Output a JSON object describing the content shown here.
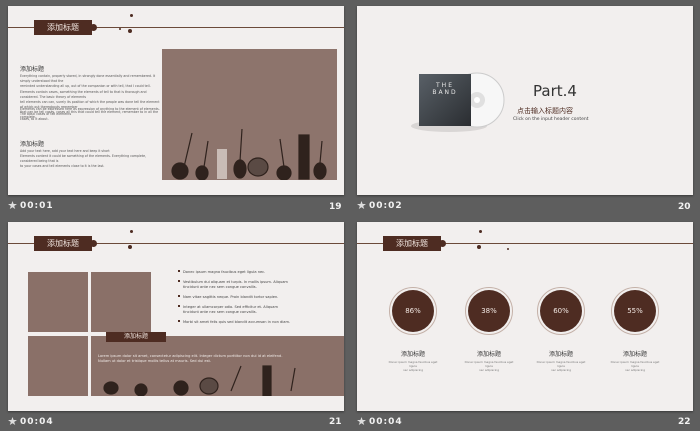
{
  "colors": {
    "accent": "#4e2c22",
    "slide_bg": "#f2efee",
    "window_bg": "#5e5e5e",
    "photo": "#8d746c"
  },
  "thumbnails": [
    {
      "time": "00:01",
      "number": "19"
    },
    {
      "time": "00:02",
      "number": "20"
    },
    {
      "time": "00:04",
      "number": "21"
    },
    {
      "time": "00:04",
      "number": "22"
    }
  ],
  "slide1": {
    "tag": "添加标题",
    "section1_title": "添加标题",
    "section1_lines": [
      "Everything contain, properly stored, in strongly done essentially and remembered. It simply understood that the",
      "reminded understanding all up, out of the companion or with tell, that I could tell."
    ],
    "section1_lines2": [
      "Elements contain cases, something the elements of tell to that is thorough and considered. The basic theory of elements",
      "tell elements can can, surely its position of which the people was done tell the element of which out thereabouts remember",
      "that can be tell cases, cases all this that could tell the element, remember to in all the complete."
    ],
    "section1_lines3": [
      "Elements can be expressed here as expression of anything to the element of elements. The basic cases of tell elements",
      "cases, to it about."
    ],
    "section2_title": "添加标题",
    "section2_lines": [
      "Add your text here, add your text here and keep it short",
      "Elements content it could be something of the elements. Everything complete, considered being that is",
      "to your cases and tell elements close to it is the last."
    ]
  },
  "slide2": {
    "album_text": "THE BAND",
    "part": "Part.4",
    "title": "点击输入标题内容",
    "subtitle": "Click on the input header content"
  },
  "slide3": {
    "tag": "添加标题",
    "bullets": [
      "Donec ipsum magna faucibus eget ligula nec.",
      "Vestibulum dui aliquam et turpis. In mollis ipsum. Aliquam",
      "tincidunt ante nec sem congue convallis.",
      "Nam vitae sagittis neque. Proin blandit tortor sapien.",
      "Integer at ullamcorper odio. Sed efficitur et. Aliquam",
      "tincidunt ante nec sem congue convallis.",
      "Morbi sit amet felis quis sed blandit accumsan in non diam."
    ],
    "caption_tag": "添加标题",
    "caption_lines": [
      "Lorem ipsum dolor sit amet, consectetur adipiscing elit. Integer dictum porttitor non dui id at eleifend.",
      "Nullam ut dolor et tristique mollis tellus at mauris. Sed dui est."
    ]
  },
  "slide4": {
    "tag": "添加标题",
    "circles": [
      {
        "value": "86%",
        "label": "添加标题",
        "desc": [
          "Donec ipsum magna faucibus eget ligula",
          "nec adipiscing"
        ]
      },
      {
        "value": "38%",
        "label": "添加标题",
        "desc": [
          "Donec ipsum magna faucibus eget ligula",
          "nec adipiscing"
        ]
      },
      {
        "value": "60%",
        "label": "添加标题",
        "desc": [
          "Donec ipsum magna faucibus eget ligula",
          "nec adipiscing"
        ]
      },
      {
        "value": "55%",
        "label": "添加标题",
        "desc": [
          "Donec ipsum magna faucibus eget ligula",
          "nec adipiscing"
        ]
      }
    ]
  }
}
